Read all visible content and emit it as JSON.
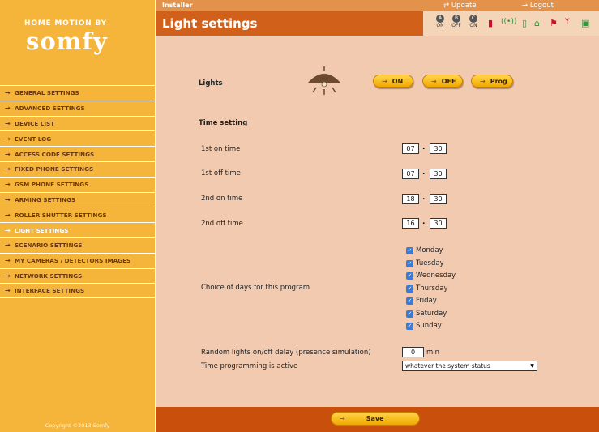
{
  "brand": {
    "top": "HOME MOTION BY",
    "logo": "somfy"
  },
  "sidebar": {
    "items": [
      {
        "label": "GENERAL SETTINGS"
      },
      {
        "label": "ADVANCED SETTINGS"
      },
      {
        "label": "DEVICE LIST"
      },
      {
        "label": "EVENT LOG"
      },
      {
        "label": "ACCESS CODE SETTINGS"
      },
      {
        "label": "FIXED PHONE SETTINGS"
      },
      {
        "label": "GSM PHONE SETTINGS"
      },
      {
        "label": "ARMING SETTINGS"
      },
      {
        "label": "ROLLER SHUTTER SETTINGS"
      },
      {
        "label": "LIGHT SETTINGS",
        "active": true
      },
      {
        "label": "SCENARIO SETTINGS"
      },
      {
        "label": "MY CAMERAS / DETECTORS IMAGES"
      },
      {
        "label": "NETWORK SETTINGS"
      },
      {
        "label": "INTERFACE SETTINGS"
      }
    ],
    "copyright": "Copyright ©2013 Somfy"
  },
  "topbar": {
    "installer": "Installer",
    "update": "Update",
    "logout": "Logout"
  },
  "title": "Light settings",
  "status": {
    "zones": [
      {
        "letter": "A",
        "state": "ON"
      },
      {
        "letter": "B",
        "state": "OFF"
      },
      {
        "letter": "C",
        "state": "ON"
      }
    ]
  },
  "lights": {
    "label": "Lights",
    "on_label": "ON",
    "off_label": "OFF",
    "prog_label": "Prog"
  },
  "time_setting": {
    "heading": "Time setting",
    "rows": [
      {
        "label": "1st on time",
        "hour": "07",
        "minute": "30"
      },
      {
        "label": "1st off time",
        "hour": "07",
        "minute": "30"
      },
      {
        "label": "2nd on time",
        "hour": "18",
        "minute": "30"
      },
      {
        "label": "2nd off time",
        "hour": "16",
        "minute": "30"
      }
    ]
  },
  "days": {
    "label": "Choice of days for this program",
    "items": [
      "Monday",
      "Tuesday",
      "Wednesday",
      "Thursday",
      "Friday",
      "Saturday",
      "Sunday"
    ]
  },
  "random_delay": {
    "label": "Random lights on/off delay (presence simulation)",
    "value": "0",
    "unit": "min"
  },
  "programming": {
    "label": "Time programming is active",
    "selected": "whatever the system status"
  },
  "footer": {
    "save_label": "Save"
  },
  "colors": {
    "sidebar": "#f5b43a",
    "title_bar": "#d0601a",
    "content": "#f1cab0",
    "footer": "#c8500c"
  }
}
